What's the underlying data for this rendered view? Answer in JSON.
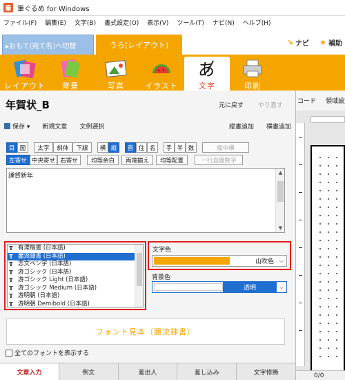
{
  "window": {
    "title": "筆ぐるめ for Windows"
  },
  "menu": [
    "ファイル(F)",
    "編集(E)",
    "文字(B)",
    "書式設定(O)",
    "表示(V)",
    "ツール(T)",
    "ナビ(N)",
    "ヘルプ(H)"
  ],
  "side_tabs": {
    "front": "▸おもて(宛て名)へ切替",
    "back": "うら(レイアウト)"
  },
  "top_links": {
    "navi": "ナビ",
    "help": "補助"
  },
  "ribbon": [
    {
      "label": "レイアウト",
      "icon": "layout-icon"
    },
    {
      "label": "背景",
      "icon": "background-icon"
    },
    {
      "label": "写真",
      "icon": "photo-icon"
    },
    {
      "label": "イラスト",
      "icon": "illustration-icon"
    },
    {
      "label": "文字",
      "icon": "character-icon",
      "active": true
    },
    {
      "label": "印刷",
      "icon": "printer-icon"
    }
  ],
  "panel": {
    "title": "年賀状_B",
    "undo": "元に戻す",
    "redo": "やり直す",
    "toolbar": {
      "save": "保存 ▾",
      "new_text": "新規文章",
      "select_example": "文例選択",
      "add_vertical": "縦書追加",
      "add_horizontal": "横書追加"
    },
    "row1": [
      "目",
      "圀",
      "太字",
      "斜体",
      "下線",
      "横",
      "縦",
      "普",
      "住",
      "名",
      "手",
      "半",
      "数",
      "縦中横"
    ],
    "row2": [
      "左寄せ",
      "中央寄せ",
      "右寄せ",
      "均等余白",
      "両端揃え",
      "均等配置",
      "一行自護数字"
    ],
    "text_content": "謹賀新年",
    "fonts": [
      "有澤楷書 (日本語)",
      "麗流隷書 (日本語)",
      "恋文ペン字 (日本語)",
      "游ゴシック (日本語)",
      "游ゴシック Light (日本語)",
      "游ゴシック Medium (日本語)",
      "游明朝 (日本語)",
      "游明朝 Demibold (日本語)"
    ],
    "selected_font_index": 1,
    "text_color_label": "文字色",
    "text_color": {
      "name": "山吹色",
      "hex": "#f5a500"
    },
    "bg_color_label": "背景色",
    "bg_color": {
      "name": "透明"
    },
    "preview": "フォント見本（麗流隷書）",
    "show_all_fonts": "全てのフォントを表示する",
    "bottom_tabs": [
      "文章入力",
      "例文",
      "差出人",
      "差し込み",
      "文字修飾"
    ]
  },
  "right_pane": {
    "top": [
      "コード",
      "領域設定"
    ],
    "status": "0/0"
  },
  "colors": {
    "accent": "#f5a500",
    "selection": "#1f6fd1",
    "highlight": "#e31c1c"
  }
}
